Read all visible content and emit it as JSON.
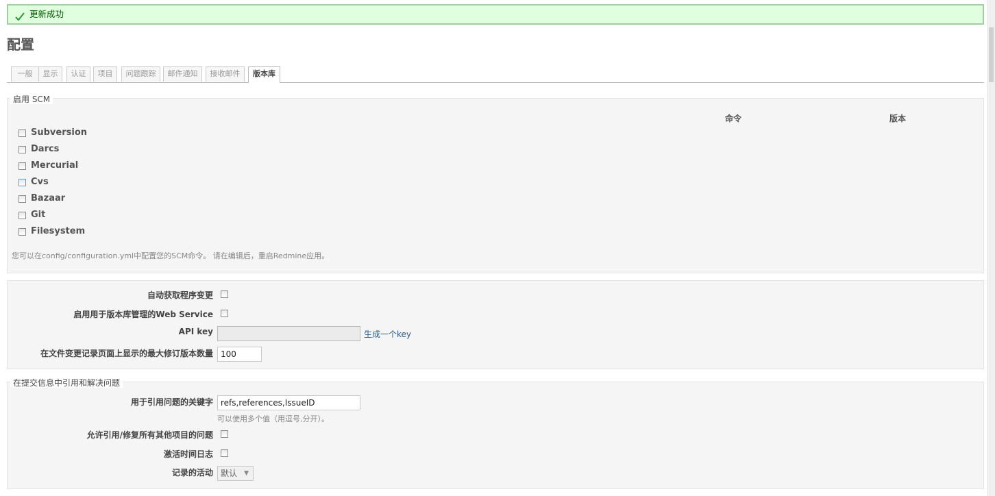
{
  "flash": {
    "message": "更新成功",
    "icon": "checkmark-icon"
  },
  "page": {
    "title": "配置"
  },
  "tabs": [
    {
      "label": "一般"
    },
    {
      "label": "显示"
    },
    {
      "label": "认证"
    },
    {
      "label": "项目"
    },
    {
      "label": "问题跟踪"
    },
    {
      "label": "邮件通知"
    },
    {
      "label": "接收邮件"
    },
    {
      "label": "版本库"
    }
  ],
  "active_tab": "版本库",
  "scm": {
    "legend": "启用 SCM",
    "col_command": "命令",
    "col_version": "版本",
    "items": [
      {
        "label": "Subversion",
        "checked": false
      },
      {
        "label": "Darcs",
        "checked": false
      },
      {
        "label": "Mercurial",
        "checked": false
      },
      {
        "label": "Cvs",
        "checked": false
      },
      {
        "label": "Bazaar",
        "checked": false
      },
      {
        "label": "Git",
        "checked": false
      },
      {
        "label": "Filesystem",
        "checked": false
      }
    ],
    "note": "您可以在config/configuration.yml中配置您的SCM命令。 请在编辑后，重启Redmine应用。"
  },
  "settings": {
    "autofetch_label": "自动获取程序变更",
    "ws_label": "启用用于版本库管理的Web Service",
    "api_key_label": "API key",
    "api_key_value": "",
    "generate_key_link": "生成一个key",
    "max_revisions_label": "在文件变更记录页面上显示的最大修订版本数量",
    "max_revisions_value": "100"
  },
  "refs": {
    "legend": "在提交信息中引用和解决问题",
    "keywords_label": "用于引用问题的关键字",
    "keywords_value": "refs,references,IssueID",
    "keywords_hint": "可以使用多个值（用逗号,分开）。",
    "cross_project_label": "允许引用/修复所有其他项目的问题",
    "time_log_label": "激活时间日志",
    "activity_label": "记录的活动",
    "activity_value": "默认"
  }
}
